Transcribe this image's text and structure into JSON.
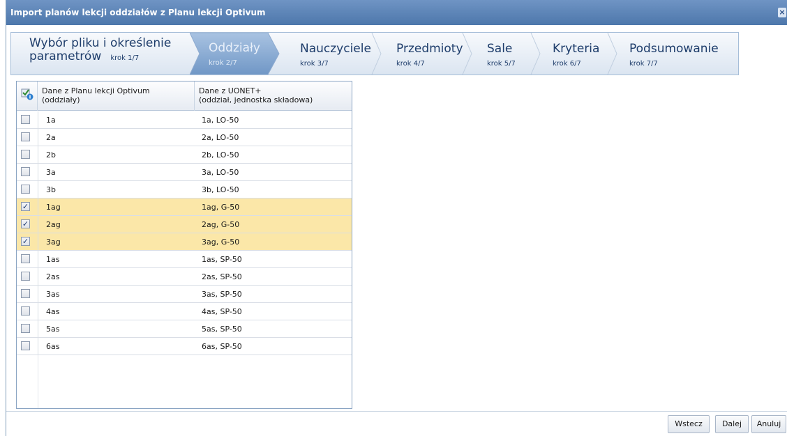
{
  "window": {
    "title": "Import planów lekcji oddziałów z Planu lekcji Optivum",
    "close_label": "×"
  },
  "wizard": {
    "steps": [
      {
        "line1": "Wybór pliku i określenie",
        "line2": "parametrów",
        "sub": "krok 1/7"
      },
      {
        "label": "Oddziały",
        "sub": "krok 2/7"
      },
      {
        "label": "Nauczyciele",
        "sub": "krok 3/7"
      },
      {
        "label": "Przedmioty",
        "sub": "krok 4/7"
      },
      {
        "label": "Sale",
        "sub": "krok 5/7"
      },
      {
        "label": "Kryteria",
        "sub": "krok 6/7"
      },
      {
        "label": "Podsumowanie",
        "sub": "krok 7/7"
      }
    ]
  },
  "grid": {
    "columns": [
      {
        "line1": "Dane z Planu lekcji Optivum",
        "line2": "(oddziały)"
      },
      {
        "line1": "Dane z UONET+",
        "line2": "(oddział, jednostka składowa)"
      }
    ],
    "rows": [
      {
        "source": "1a",
        "target": "1a, LO-50",
        "checked": false
      },
      {
        "source": "2a",
        "target": "2a, LO-50",
        "checked": false
      },
      {
        "source": "2b",
        "target": "2b, LO-50",
        "checked": false
      },
      {
        "source": "3a",
        "target": "3a, LO-50",
        "checked": false
      },
      {
        "source": "3b",
        "target": "3b, LO-50",
        "checked": false
      },
      {
        "source": "1ag",
        "target": "1ag, G-50",
        "checked": true
      },
      {
        "source": "2ag",
        "target": "2ag, G-50",
        "checked": true
      },
      {
        "source": "3ag",
        "target": "3ag, G-50",
        "checked": true
      },
      {
        "source": "1as",
        "target": "1as, SP-50",
        "checked": false
      },
      {
        "source": "2as",
        "target": "2as, SP-50",
        "checked": false
      },
      {
        "source": "3as",
        "target": "3as, SP-50",
        "checked": false
      },
      {
        "source": "4as",
        "target": "4as, SP-50",
        "checked": false
      },
      {
        "source": "5as",
        "target": "5as, SP-50",
        "checked": false
      },
      {
        "source": "6as",
        "target": "6as, SP-50",
        "checked": false
      }
    ]
  },
  "footer": {
    "back_label": "Wstecz",
    "next_label": "Dalej",
    "cancel_label": "Anuluj"
  }
}
